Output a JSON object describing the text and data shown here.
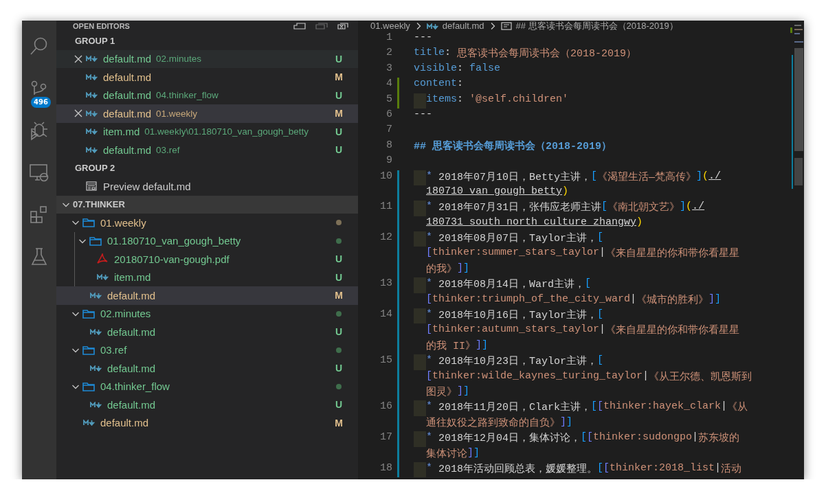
{
  "activity_bar": {
    "items": [
      {
        "kind": "search"
      },
      {
        "kind": "source-control",
        "badge": "496"
      },
      {
        "kind": "debug"
      },
      {
        "kind": "remote"
      },
      {
        "kind": "extensions"
      },
      {
        "kind": "test"
      }
    ]
  },
  "open_editors": {
    "title": "OPEN EDITORS",
    "groups": [
      {
        "title": "GROUP 1",
        "items": [
          {
            "kind": "markdown",
            "name": "default.md",
            "path": "02.minutes",
            "status": "U",
            "close_visible": true,
            "hovered": true,
            "selected": false
          },
          {
            "kind": "markdown",
            "name": "default.md",
            "status": "M",
            "close_visible": false,
            "hovered": false,
            "selected": false
          },
          {
            "kind": "markdown",
            "name": "default.md",
            "path": "04.thinker_flow",
            "status": "U",
            "close_visible": false,
            "hovered": false,
            "selected": false
          },
          {
            "kind": "markdown",
            "name": "default.md",
            "path": "01.weekly",
            "status": "M",
            "close_visible": true,
            "hovered": false,
            "selected": true
          },
          {
            "kind": "markdown",
            "name": "item.md",
            "path": "01.weekly\\01.180710_van_gough_betty",
            "status": "U",
            "close_visible": false,
            "hovered": false,
            "selected": false
          },
          {
            "kind": "markdown",
            "name": "default.md",
            "path": "03.ref",
            "status": "U",
            "close_visible": false,
            "hovered": false,
            "selected": false
          }
        ]
      },
      {
        "title": "GROUP 2",
        "items": [
          {
            "kind": "preview",
            "name": "Preview default.md",
            "close_visible": false,
            "hovered": false,
            "selected": false
          }
        ]
      }
    ]
  },
  "explorer": {
    "title": "07.THINKER",
    "expanded": true,
    "items": [
      {
        "kind": "folder",
        "name": "01.weekly",
        "expanded": true,
        "color": "#7d7057",
        "selected": false,
        "children": [
          {
            "kind": "folder",
            "name": "01.180710_van_gough_betty",
            "expanded": true,
            "color": "#3f6e4c",
            "selected": false,
            "children": [
              {
                "kind": "pdf",
                "name": "20180710-van-gough.pdf",
                "status": "U",
                "selected": false
              },
              {
                "kind": "markdown",
                "name": "item.md",
                "status": "U",
                "selected": false
              }
            ]
          },
          {
            "kind": "markdown",
            "name": "default.md",
            "status": "M",
            "selected": true
          }
        ]
      },
      {
        "kind": "folder",
        "name": "02.minutes",
        "expanded": true,
        "color": "#3f6e4c",
        "selected": false,
        "children": [
          {
            "kind": "markdown",
            "name": "default.md",
            "status": "U",
            "selected": false
          }
        ]
      },
      {
        "kind": "folder",
        "name": "03.ref",
        "expanded": true,
        "color": "#3f6e4c",
        "selected": false,
        "children": [
          {
            "kind": "markdown",
            "name": "default.md",
            "status": "U",
            "selected": false
          }
        ]
      },
      {
        "kind": "folder",
        "name": "04.thinker_flow",
        "expanded": true,
        "color": "#3f6e4c",
        "selected": false,
        "children": [
          {
            "kind": "markdown",
            "name": "default.md",
            "status": "U",
            "selected": false
          }
        ]
      },
      {
        "kind": "markdown",
        "name": "default.md",
        "status": "M",
        "selected": false
      }
    ]
  },
  "editor": {
    "breadcrumb": [
      {
        "kind": "folder",
        "text": "01.weekly"
      },
      {
        "kind": "markdown",
        "text": "default.md"
      },
      {
        "kind": "heading",
        "text": "## 思客读书会每周读书会（2018-2019）"
      }
    ],
    "lines": [
      {
        "number": "1",
        "added": false,
        "modified": false,
        "indented": false,
        "wrapped": [
          {
            "tokens": [
              {
                "kind": "punct",
                "text": "---"
              }
            ]
          }
        ]
      },
      {
        "number": "2",
        "added": false,
        "modified": false,
        "indented": false,
        "wrapped": [
          {
            "tokens": [
              {
                "kind": "key",
                "text": "title"
              },
              {
                "kind": "punct",
                "text": ": "
              },
              {
                "kind": "string",
                "text": "思客读书会每周读书会（2018-2019）"
              }
            ]
          }
        ]
      },
      {
        "number": "3",
        "added": false,
        "modified": false,
        "indented": false,
        "wrapped": [
          {
            "tokens": [
              {
                "kind": "key",
                "text": "visible"
              },
              {
                "kind": "punct",
                "text": ": "
              },
              {
                "kind": "bool",
                "text": "false"
              }
            ]
          }
        ]
      },
      {
        "number": "4",
        "added": true,
        "modified": false,
        "indented": false,
        "wrapped": [
          {
            "tokens": [
              {
                "kind": "key",
                "text": "content"
              },
              {
                "kind": "punct",
                "text": ":"
              }
            ]
          }
        ]
      },
      {
        "number": "5",
        "added": true,
        "modified": false,
        "indented": true,
        "wrapped": [
          {
            "tokens": [
              {
                "kind": "key",
                "text": "items"
              },
              {
                "kind": "punct",
                "text": ": "
              },
              {
                "kind": "string",
                "text": "'@self.children'"
              }
            ]
          }
        ]
      },
      {
        "number": "6",
        "added": false,
        "modified": false,
        "indented": false,
        "wrapped": [
          {
            "tokens": [
              {
                "kind": "punct",
                "text": "---"
              }
            ]
          }
        ]
      },
      {
        "number": "7",
        "added": false,
        "modified": false,
        "indented": false
      },
      {
        "number": "8",
        "added": false,
        "modified": false,
        "indented": false,
        "wrapped": [
          {
            "tokens": [
              {
                "kind": "heading",
                "text": "## 思客读书会每周读书会（2018-2019）"
              }
            ]
          }
        ]
      },
      {
        "number": "9",
        "added": false,
        "modified": false,
        "indented": false
      },
      {
        "number": "10",
        "added": false,
        "modified": true,
        "indented": true,
        "wrapped": [
          {
            "tokens": [
              {
                "kind": "bullet",
                "text": "*"
              },
              {
                "kind": "plain",
                "text": " 2018年07月10日，Betty主讲，"
              },
              {
                "kind": "bracket",
                "text": "["
              },
              {
                "kind": "linktext",
                "text": "《渴望生活—梵高传》"
              },
              {
                "kind": "bracket",
                "text": "]"
              },
              {
                "kind": "paren",
                "text": "("
              },
              {
                "kind": "url",
                "text": "./"
              }
            ]
          },
          {
            "tokens": [
              {
                "kind": "url",
                "text": "180710_van_gough_betty"
              },
              {
                "kind": "paren",
                "text": ")"
              }
            ]
          }
        ]
      },
      {
        "number": "11",
        "added": false,
        "modified": true,
        "indented": true,
        "wrapped": [
          {
            "tokens": [
              {
                "kind": "bullet",
                "text": "*"
              },
              {
                "kind": "plain",
                "text": " 2018年07月31日，张伟应老师主讲"
              },
              {
                "kind": "bracket",
                "text": "["
              },
              {
                "kind": "linktext",
                "text": "《南北朝文艺》"
              },
              {
                "kind": "bracket",
                "text": "]"
              },
              {
                "kind": "paren",
                "text": "("
              },
              {
                "kind": "url",
                "text": "./"
              }
            ]
          },
          {
            "tokens": [
              {
                "kind": "url",
                "text": "180731_south_north_culture_zhangwy"
              },
              {
                "kind": "paren",
                "text": ")"
              }
            ]
          }
        ]
      },
      {
        "number": "12",
        "added": false,
        "modified": true,
        "indented": true,
        "wrapped": [
          {
            "tokens": [
              {
                "kind": "bullet",
                "text": "*"
              },
              {
                "kind": "plain",
                "text": " 2018年08月07日，Taylor主讲，"
              },
              {
                "kind": "bracket",
                "text": "["
              }
            ]
          },
          {
            "tokens": [
              {
                "kind": "bracket2",
                "text": "["
              },
              {
                "kind": "linktext",
                "text": "thinker:summer_stars_taylor"
              },
              {
                "kind": "plain",
                "text": "|"
              },
              {
                "kind": "linktext",
                "text": "《来自星星的你和带你看星星"
              }
            ]
          },
          {
            "tokens": [
              {
                "kind": "linktext",
                "text": "的我》"
              },
              {
                "kind": "bracket2",
                "text": "]"
              },
              {
                "kind": "bracket",
                "text": "]"
              }
            ]
          }
        ]
      },
      {
        "number": "13",
        "added": false,
        "modified": true,
        "indented": true,
        "wrapped": [
          {
            "tokens": [
              {
                "kind": "bullet",
                "text": "*"
              },
              {
                "kind": "plain",
                "text": " 2018年08月14日，Ward主讲，"
              },
              {
                "kind": "bracket",
                "text": "["
              }
            ]
          },
          {
            "tokens": [
              {
                "kind": "bracket2",
                "text": "["
              },
              {
                "kind": "linktext",
                "text": "thinker:triumph_of_the_city_ward"
              },
              {
                "kind": "plain",
                "text": "|"
              },
              {
                "kind": "linktext",
                "text": "《城市的胜利》"
              },
              {
                "kind": "bracket2",
                "text": "]"
              },
              {
                "kind": "bracket",
                "text": "]"
              }
            ]
          }
        ]
      },
      {
        "number": "14",
        "added": false,
        "modified": true,
        "indented": true,
        "wrapped": [
          {
            "tokens": [
              {
                "kind": "bullet",
                "text": "*"
              },
              {
                "kind": "plain",
                "text": " 2018年10月16日，Taylor主讲，"
              },
              {
                "kind": "bracket",
                "text": "["
              }
            ]
          },
          {
            "tokens": [
              {
                "kind": "bracket2",
                "text": "["
              },
              {
                "kind": "linktext",
                "text": "thinker:autumn_stars_taylor"
              },
              {
                "kind": "plain",
                "text": "|"
              },
              {
                "kind": "linktext",
                "text": "《来自星星的你和带你看星星"
              }
            ]
          },
          {
            "tokens": [
              {
                "kind": "linktext",
                "text": "的我 II》"
              },
              {
                "kind": "bracket2",
                "text": "]"
              },
              {
                "kind": "bracket",
                "text": "]"
              }
            ]
          }
        ]
      },
      {
        "number": "15",
        "added": false,
        "modified": true,
        "indented": true,
        "wrapped": [
          {
            "tokens": [
              {
                "kind": "bullet",
                "text": "*"
              },
              {
                "kind": "plain",
                "text": " 2018年10月23日，Taylor主讲，"
              },
              {
                "kind": "bracket",
                "text": "["
              }
            ]
          },
          {
            "tokens": [
              {
                "kind": "bracket2",
                "text": "["
              },
              {
                "kind": "linktext",
                "text": "thinker:wilde_kaynes_turing_taylor"
              },
              {
                "kind": "plain",
                "text": "|"
              },
              {
                "kind": "linktext",
                "text": "《从王尔德、凯恩斯到"
              }
            ]
          },
          {
            "tokens": [
              {
                "kind": "linktext",
                "text": "图灵》"
              },
              {
                "kind": "bracket2",
                "text": "]"
              },
              {
                "kind": "bracket",
                "text": "]"
              }
            ]
          }
        ]
      },
      {
        "number": "16",
        "added": false,
        "modified": true,
        "indented": true,
        "wrapped": [
          {
            "tokens": [
              {
                "kind": "bullet",
                "text": "*"
              },
              {
                "kind": "plain",
                "text": " 2018年11月20日，Clark主讲，"
              },
              {
                "kind": "bracket",
                "text": "["
              },
              {
                "kind": "bracket2",
                "text": "["
              },
              {
                "kind": "linktext",
                "text": "thinker:hayek_clark"
              },
              {
                "kind": "plain",
                "text": "|"
              },
              {
                "kind": "linktext",
                "text": "《从"
              }
            ]
          },
          {
            "tokens": [
              {
                "kind": "linktext",
                "text": "通往奴役之路到致命的自负》"
              },
              {
                "kind": "bracket2",
                "text": "]"
              },
              {
                "kind": "bracket",
                "text": "]"
              }
            ]
          }
        ]
      },
      {
        "number": "17",
        "added": false,
        "modified": true,
        "indented": true,
        "wrapped": [
          {
            "tokens": [
              {
                "kind": "bullet",
                "text": "*"
              },
              {
                "kind": "plain",
                "text": " 2018年12月04日，集体讨论，"
              },
              {
                "kind": "bracket",
                "text": "["
              },
              {
                "kind": "bracket2",
                "text": "["
              },
              {
                "kind": "linktext",
                "text": "thinker:sudongpo"
              },
              {
                "kind": "plain",
                "text": "|"
              },
              {
                "kind": "linktext",
                "text": "苏东坡的"
              }
            ]
          },
          {
            "tokens": [
              {
                "kind": "linktext",
                "text": "集体讨论"
              },
              {
                "kind": "bracket2",
                "text": "]"
              },
              {
                "kind": "bracket",
                "text": "]"
              }
            ]
          }
        ]
      },
      {
        "number": "18",
        "added": false,
        "modified": true,
        "indented": true,
        "wrapped": [
          {
            "tokens": [
              {
                "kind": "bullet",
                "text": "*"
              },
              {
                "kind": "plain",
                "text": " 2018年活动回顾总表，媛媛整理。"
              },
              {
                "kind": "bracket",
                "text": "["
              },
              {
                "kind": "bracket2",
                "text": "["
              },
              {
                "kind": "linktext",
                "text": "thinker:2018_list"
              },
              {
                "kind": "plain",
                "text": "|"
              },
              {
                "kind": "linktext",
                "text": "活动"
              }
            ]
          }
        ]
      }
    ]
  }
}
